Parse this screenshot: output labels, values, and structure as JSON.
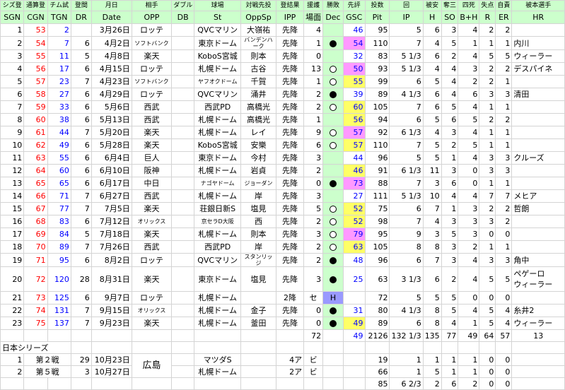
{
  "header_row1": [
    "シズ登",
    "通算登",
    "チム試",
    "登間",
    "月日",
    "相手",
    "ダブル",
    "球場",
    "対戦先投",
    "登結果",
    "援護",
    "勝敗",
    "先評",
    "投数",
    "回",
    "被安",
    "奪三",
    "四死",
    "失点",
    "自責",
    "被本選手"
  ],
  "header_row2": [
    "SGN",
    "CGN",
    "TGN",
    "DR",
    "Date",
    "OPP",
    "DB",
    "St",
    "OppSp",
    "IPP",
    "場面",
    "Dec",
    "GSC",
    "Pit",
    "IP",
    "H",
    "SO",
    "B+H",
    "R",
    "ER",
    "HR"
  ],
  "rows": [
    {
      "sgn": "1",
      "cgn": "53",
      "tgn": "2",
      "dr": "",
      "date": "3月26日",
      "opp": "ロッテ",
      "st": "QVCマリン",
      "oppsp": "大嶺祐",
      "ipp": "先降",
      "sup": "4",
      "dec": "",
      "gsc": "46",
      "gsc_color": "",
      "pit": "95",
      "ip": "5",
      "h": "6",
      "so": "3",
      "bh": "4",
      "r": "2",
      "er": "2",
      "hr": ""
    },
    {
      "sgn": "2",
      "cgn": "54",
      "tgn": "7",
      "dr": "6",
      "date": "4月2日",
      "opp": "ソフトバンク",
      "opp_small": true,
      "st": "東京ドーム",
      "oppsp": "バンデンハーク",
      "oppsp_small": true,
      "ipp": "先降",
      "sup": "1",
      "dec": "win",
      "gsc": "54",
      "gsc_color": "pink",
      "pit": "110",
      "ip": "7",
      "h": "4",
      "so": "5",
      "bh": "1",
      "r": "1",
      "er": "1",
      "hr": "内川"
    },
    {
      "sgn": "3",
      "cgn": "55",
      "tgn": "11",
      "dr": "5",
      "date": "4月8日",
      "opp": "楽天",
      "st": "KoboS宮城",
      "oppsp": "則本",
      "ipp": "先降",
      "sup": "0",
      "dec": "",
      "gsc": "32",
      "gsc_color": "",
      "pit": "83",
      "ip": "5 1/3",
      "h": "6",
      "so": "2",
      "bh": "4",
      "r": "5",
      "er": "5",
      "hr": "ウィーラー"
    },
    {
      "sgn": "4",
      "cgn": "56",
      "tgn": "17",
      "dr": "6",
      "date": "4月15日",
      "opp": "ロッテ",
      "st": "札幌ドーム",
      "oppsp": "古谷",
      "ipp": "先降",
      "sup": "13",
      "dec": "lose",
      "gsc": "50",
      "gsc_color": "pink",
      "pit": "93",
      "ip": "5 1/3",
      "h": "4",
      "so": "4",
      "bh": "3",
      "r": "2",
      "er": "2",
      "hr": "デスパイネ"
    },
    {
      "sgn": "5",
      "cgn": "57",
      "tgn": "23",
      "dr": "7",
      "date": "4月23日",
      "opp": "ソフトバンク",
      "opp_small": true,
      "st": "ヤフオクドーム",
      "st_small": true,
      "oppsp": "千賀",
      "ipp": "先降",
      "sup": "1",
      "dec": "lose",
      "gsc": "55",
      "gsc_color": "yellow",
      "pit": "99",
      "ip": "6",
      "h": "5",
      "so": "4",
      "bh": "2",
      "r": "2",
      "er": "1",
      "hr": ""
    },
    {
      "sgn": "6",
      "cgn": "58",
      "tgn": "27",
      "dr": "6",
      "date": "4月29日",
      "opp": "ロッテ",
      "st": "QVCマリン",
      "oppsp": "涌井",
      "ipp": "先降",
      "sup": "2",
      "dec": "win",
      "gsc": "39",
      "gsc_color": "",
      "pit": "89",
      "ip": "4 1/3",
      "h": "6",
      "so": "4",
      "bh": "6",
      "r": "3",
      "er": "3",
      "hr": "清田"
    },
    {
      "sgn": "7",
      "cgn": "59",
      "tgn": "33",
      "dr": "6",
      "date": "5月6日",
      "opp": "西武",
      "st": "西武PD",
      "oppsp": "高橋光",
      "ipp": "先降",
      "sup": "2",
      "dec": "lose",
      "gsc": "60",
      "gsc_color": "yellow",
      "pit": "105",
      "ip": "7",
      "h": "6",
      "so": "5",
      "bh": "4",
      "r": "1",
      "er": "1",
      "hr": ""
    },
    {
      "sgn": "8",
      "cgn": "60",
      "tgn": "38",
      "dr": "6",
      "date": "5月13日",
      "opp": "西武",
      "st": "札幌ドーム",
      "oppsp": "高橋光",
      "ipp": "先降",
      "sup": "1",
      "dec": "",
      "gsc": "56",
      "gsc_color": "yellow",
      "pit": "94",
      "ip": "6",
      "h": "5",
      "so": "6",
      "bh": "5",
      "r": "2",
      "er": "2",
      "hr": ""
    },
    {
      "sgn": "9",
      "cgn": "61",
      "tgn": "44",
      "dr": "7",
      "date": "5月20日",
      "opp": "楽天",
      "st": "札幌ドーム",
      "oppsp": "レイ",
      "ipp": "先降",
      "sup": "9",
      "dec": "lose",
      "gsc": "57",
      "gsc_color": "pink",
      "pit": "92",
      "ip": "6 1/3",
      "h": "4",
      "so": "3",
      "bh": "4",
      "r": "1",
      "er": "1",
      "hr": ""
    },
    {
      "sgn": "10",
      "cgn": "62",
      "tgn": "49",
      "dr": "6",
      "date": "5月28日",
      "opp": "楽天",
      "st": "KoboS宮城",
      "oppsp": "安樂",
      "ipp": "先降",
      "sup": "6",
      "dec": "lose",
      "gsc": "57",
      "gsc_color": "yellow",
      "pit": "110",
      "ip": "7",
      "h": "5",
      "so": "2",
      "bh": "5",
      "r": "1",
      "er": "1",
      "hr": ""
    },
    {
      "sgn": "11",
      "cgn": "63",
      "tgn": "55",
      "dr": "6",
      "date": "6月4日",
      "opp": "巨人",
      "st": "東京ドーム",
      "oppsp": "今村",
      "ipp": "先降",
      "sup": "3",
      "dec": "",
      "gsc": "44",
      "gsc_color": "",
      "pit": "96",
      "ip": "5",
      "h": "5",
      "so": "1",
      "bh": "4",
      "r": "3",
      "er": "3",
      "hr": "クルーズ"
    },
    {
      "sgn": "12",
      "cgn": "64",
      "tgn": "60",
      "dr": "6",
      "date": "6月10日",
      "opp": "阪神",
      "st": "札幌ドーム",
      "oppsp": "岩貞",
      "ipp": "先降",
      "sup": "2",
      "dec": "",
      "gsc": "46",
      "gsc_color": "yellow",
      "pit": "91",
      "ip": "6 1/3",
      "h": "11",
      "so": "3",
      "bh": "0",
      "r": "3",
      "er": "3",
      "hr": ""
    },
    {
      "sgn": "13",
      "cgn": "65",
      "tgn": "65",
      "dr": "6",
      "date": "6月17日",
      "opp": "中日",
      "st": "ナゴヤドーム",
      "st_small": true,
      "oppsp": "ジョーダン",
      "oppsp_small": true,
      "ipp": "先降",
      "sup": "0",
      "dec": "win",
      "gsc": "73",
      "gsc_color": "pink",
      "pit": "88",
      "ip": "7",
      "h": "3",
      "so": "6",
      "bh": "0",
      "r": "1",
      "er": "1",
      "hr": ""
    },
    {
      "sgn": "14",
      "cgn": "66",
      "tgn": "71",
      "dr": "7",
      "date": "6月27日",
      "opp": "西武",
      "st": "札幌ドーム",
      "oppsp": "岸",
      "ipp": "先降",
      "sup": "3",
      "dec": "",
      "gsc": "27",
      "gsc_color": "",
      "pit": "111",
      "ip": "5 1/3",
      "h": "10",
      "so": "4",
      "bh": "4",
      "r": "7",
      "er": "7",
      "hr": "メヒア"
    },
    {
      "sgn": "15",
      "cgn": "67",
      "tgn": "77",
      "dr": "7",
      "date": "7月5日",
      "opp": "楽天",
      "st": "荘銀日新S",
      "oppsp": "塩見",
      "ipp": "先降",
      "sup": "5",
      "dec": "lose",
      "gsc": "52",
      "gsc_color": "yellow",
      "pit": "75",
      "ip": "6",
      "h": "7",
      "so": "1",
      "bh": "3",
      "r": "2",
      "er": "2",
      "hr": "哲朗"
    },
    {
      "sgn": "16",
      "cgn": "68",
      "tgn": "83",
      "dr": "6",
      "date": "7月12日",
      "opp": "オリックス",
      "opp_small": true,
      "st": "京セラD大阪",
      "st_small": true,
      "oppsp": "西",
      "ipp": "先降",
      "sup": "2",
      "dec": "lose",
      "gsc": "52",
      "gsc_color": "yellow",
      "pit": "98",
      "ip": "7",
      "h": "4",
      "so": "3",
      "bh": "3",
      "r": "3",
      "er": "2",
      "hr": ""
    },
    {
      "sgn": "17",
      "cgn": "69",
      "tgn": "84",
      "dr": "5",
      "date": "7月18日",
      "opp": "楽天",
      "st": "札幌ドーム",
      "oppsp": "則本",
      "ipp": "先降",
      "sup": "3",
      "dec": "lose",
      "gsc": "79",
      "gsc_color": "pink",
      "pit": "95",
      "ip": "9",
      "h": "3",
      "so": "5",
      "bh": "3",
      "r": "0",
      "er": "0",
      "hr": ""
    },
    {
      "sgn": "18",
      "cgn": "70",
      "tgn": "89",
      "dr": "7",
      "date": "7月26日",
      "opp": "西武",
      "st": "西武PD",
      "oppsp": "岸",
      "ipp": "先降",
      "sup": "2",
      "dec": "lose",
      "gsc": "63",
      "gsc_color": "yellow",
      "pit": "105",
      "ip": "8",
      "h": "8",
      "so": "3",
      "bh": "2",
      "r": "1",
      "er": "1",
      "hr": ""
    },
    {
      "sgn": "19",
      "cgn": "71",
      "tgn": "95",
      "dr": "6",
      "date": "8月2日",
      "opp": "ロッテ",
      "st": "QVCマリン",
      "oppsp": "スタンリッジ",
      "oppsp_small": true,
      "ipp": "先降",
      "sup": "2",
      "dec": "win",
      "gsc": "48",
      "gsc_color": "",
      "pit": "96",
      "ip": "6",
      "h": "7",
      "so": "3",
      "bh": "4",
      "r": "3",
      "er": "3",
      "hr": "角中"
    },
    {
      "sgn": "20",
      "cgn": "72",
      "tgn": "120",
      "dr": "28",
      "date": "8月31日",
      "opp": "楽天",
      "st": "東京ドーム",
      "oppsp": "塩見",
      "ipp": "先降",
      "sup": "3",
      "dec": "win",
      "gsc": "25",
      "gsc_color": "",
      "pit": "63",
      "ip": "3 1/3",
      "h": "6",
      "so": "2",
      "bh": "4",
      "r": "5",
      "er": "5",
      "hr": "ペゲーロ",
      "hr2": "ウィーラー",
      "tall": true
    },
    {
      "sgn": "21",
      "cgn": "73",
      "tgn": "125",
      "dr": "6",
      "date": "9月7日",
      "opp": "ロッテ",
      "st": "札幌ドーム",
      "oppsp": "",
      "ipp": "2降",
      "sup": "セ",
      "dec": "H",
      "gsc": "",
      "gsc_color": "",
      "pit": "72",
      "ip": "5",
      "h": "5",
      "so": "5",
      "bh": "0",
      "r": "0",
      "er": "0",
      "hr": ""
    },
    {
      "sgn": "22",
      "cgn": "74",
      "tgn": "131",
      "dr": "7",
      "date": "9月15日",
      "opp": "オリックス",
      "opp_small": true,
      "st": "札幌ドーム",
      "oppsp": "金子",
      "ipp": "先降",
      "sup": "0",
      "dec": "win",
      "gsc": "31",
      "gsc_color": "",
      "pit": "80",
      "ip": "4 1/3",
      "h": "8",
      "so": "5",
      "bh": "4",
      "r": "5",
      "er": "4",
      "hr": "糸井2"
    },
    {
      "sgn": "23",
      "cgn": "75",
      "tgn": "137",
      "dr": "7",
      "date": "9月23日",
      "opp": "楽天",
      "st": "札幌ドーム",
      "oppsp": "釜田",
      "ipp": "先降",
      "sup": "0",
      "dec": "win",
      "gsc": "49",
      "gsc_color": "yellow",
      "pit": "89",
      "ip": "6",
      "h": "8",
      "so": "4",
      "bh": "1",
      "r": "5",
      "er": "4",
      "hr": "ウィーラー"
    }
  ],
  "season_total": {
    "sup": "72",
    "gsc": "49",
    "pit": "2126",
    "ip": "132 1/3",
    "h": "135",
    "so": "77",
    "bh": "49",
    "r": "64",
    "er": "57",
    "hr": "13"
  },
  "japan_series_title": "日本シリーズ",
  "japan_series": [
    {
      "no": "1",
      "game": "第２戦",
      "dr": "29",
      "date": "10月23日",
      "st": "マツダS",
      "ipp": "4ア",
      "sup": "ビ",
      "ip": "1",
      "pit": "19",
      "h": "1",
      "so": "1",
      "bh": "1",
      "r": "0",
      "er": "0"
    },
    {
      "no": "2",
      "game": "第５戦",
      "dr": "3",
      "date": "10月27日",
      "st": "札幌ドーム",
      "ipp": "2ア",
      "sup": "ビ",
      "ip": "1",
      "pit": "66",
      "h": "5",
      "so": "1",
      "bh": "1",
      "r": "0",
      "er": "0"
    }
  ],
  "japan_series_opp": "広島",
  "japan_total": {
    "pit": "85",
    "ip": "6 2/3",
    "h": "2",
    "so": "6",
    "bh": "2",
    "r": "0",
    "er": "0"
  }
}
